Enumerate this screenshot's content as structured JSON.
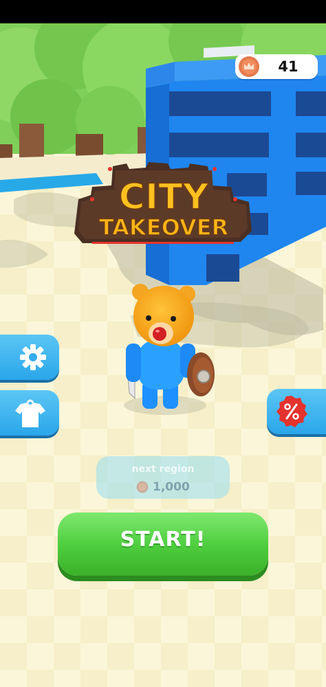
{
  "game": {
    "logo_line1": "CITY",
    "logo_line2": "TAKEOVER"
  },
  "hud": {
    "coins": "41",
    "coin_icon": "crown-coin-icon"
  },
  "side_buttons": {
    "settings_icon": "gear-icon",
    "skins_icon": "shirt-icon",
    "offer_icon": "percent-icon"
  },
  "next_region": {
    "label": "next region",
    "cost": "1,000"
  },
  "start_button": {
    "label": "START!"
  },
  "colors": {
    "building": "#1f86f0",
    "start": "#4ccc3c",
    "side_button": "#3bb3f0",
    "offer_badge": "#e4322d",
    "logo_text": "#ffb515"
  }
}
